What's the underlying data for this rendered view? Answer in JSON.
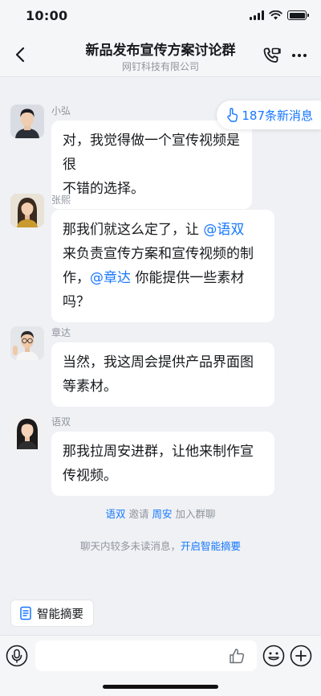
{
  "status_bar": {
    "time": "10:00"
  },
  "header": {
    "title": "新品发布宣传方案讨论群",
    "subtitle": "网钉科技有限公司",
    "icons": {
      "back": "chevron-left-icon",
      "call": "phone-call-icon",
      "more": "more-dots-icon"
    }
  },
  "new_messages": {
    "label": "187条新消息",
    "icon": "hand-pointer-icon"
  },
  "messages": [
    {
      "sender": "小弘",
      "lines": [
        "对，我觉得做一个宣传视频是很",
        "不错的选择。"
      ]
    },
    {
      "sender": "张熙",
      "line1_pre": "那我们就这么定了，让 ",
      "line1_mention": "@语双",
      "line2": "来负责宣传方案和宣传视频的制",
      "line3_pre": "作，",
      "line3_mention": "@章达",
      "line3_post": " 你能提供一些素材",
      "line4": "吗？"
    },
    {
      "sender": "章达",
      "lines": [
        "当然，我这周会提供产品界面图",
        "等素材。"
      ]
    },
    {
      "sender": "语双",
      "lines": [
        "那我拉周安进群，让他来制作宣",
        "传视频。"
      ]
    }
  ],
  "system": {
    "invite": {
      "inviter": "语双",
      "verb": " 邀请 ",
      "invitee": "周安",
      "suffix": " 加入群聊"
    },
    "summary_hint": {
      "text": "聊天内较多未读消息，",
      "link": "开启智能摘要"
    }
  },
  "summary_chip": {
    "label": "智能摘要",
    "icon": "document-icon"
  },
  "input": {
    "value": "",
    "placeholder": "",
    "icons": {
      "voice": "microphone-icon",
      "like": "thumbs-up-icon",
      "emoji": "emoji-icon",
      "plus": "plus-icon"
    }
  },
  "colors": {
    "accent": "#1677ff",
    "background": "#eff1f4",
    "bubble": "#ffffff",
    "muted_text": "#8f959e"
  }
}
